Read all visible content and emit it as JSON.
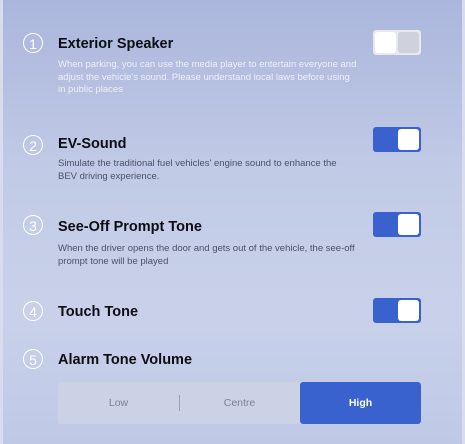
{
  "settings": [
    {
      "number": "1",
      "title": "Exterior Speaker",
      "description": "When parking, you can use the media player to entertain everyone and adjust the vehicle's sound. Please understand local laws before using in public places",
      "toggle": "off"
    },
    {
      "number": "2",
      "title": "EV-Sound",
      "description": "Simulate the traditional fuel vehicles' engine sound to enhance the BEV driving experience.",
      "toggle": "on"
    },
    {
      "number": "3",
      "title": "See-Off Prompt Tone",
      "description": "When the driver opens the door and gets out of the vehicle, the see-off prompt tone will be played",
      "toggle": "on"
    },
    {
      "number": "4",
      "title": "Touch Tone",
      "toggle": "on"
    },
    {
      "number": "5",
      "title": "Alarm Tone Volume"
    }
  ],
  "alarm_volume": {
    "options": [
      "Low",
      "Centre",
      "High"
    ],
    "selected": "High"
  },
  "colors": {
    "accent": "#3a62cf",
    "toggle_off": "#e7e9ef"
  }
}
